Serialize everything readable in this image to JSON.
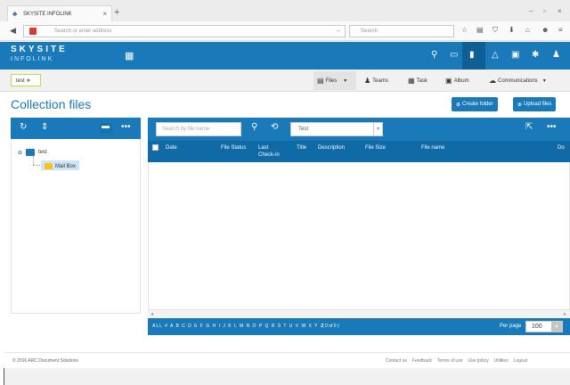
{
  "browser": {
    "tab_title": "SKYSITE INFOLINK",
    "tab_close": "×",
    "new_tab": "+",
    "url_placeholder": "Search or enter address",
    "search_placeholder": "Search",
    "window_controls": [
      "–",
      "▫",
      "×"
    ]
  },
  "app": {
    "logo_top": "SKYSITE",
    "logo_bottom": "INFOLINK",
    "project_selector": "test ≑",
    "nav": [
      {
        "icon": "files-icon",
        "label": "Files",
        "glyph": "▤"
      },
      {
        "icon": "teams-icon",
        "label": "Teams",
        "glyph": "♟"
      },
      {
        "icon": "task-icon",
        "label": "Task",
        "glyph": "▦"
      },
      {
        "icon": "album-icon",
        "label": "Album",
        "glyph": "▣"
      },
      {
        "icon": "communications-icon",
        "label": "Communications",
        "glyph": "☁"
      }
    ],
    "page_title": "Collection files",
    "create_folder": "Create folder",
    "upload_files": "Upload files"
  },
  "tree": {
    "root": "test",
    "child": "Mail Box"
  },
  "files": {
    "search_placeholder": "Search by file name",
    "folder_select": "Test",
    "columns": [
      "Date",
      "File Status",
      "Last Check-in",
      "Title",
      "Description",
      "File Size",
      "File name",
      "Do"
    ],
    "alphabet": "ALL # A B C D E F G H I J K L M N O P Q R S T U V W X Y Z",
    "count": "( 0 of 0 )",
    "per_page_label": "Per page",
    "per_page_value": "100"
  },
  "footer": {
    "copyright": "© 2016 ARC Document Solutions",
    "links": [
      "Contact us",
      "Feedback",
      "Terms of use",
      "Use policy",
      "Utilities",
      "Logout"
    ]
  },
  "colors": {
    "brand_blue": "#1a79b8",
    "header_dark": "#0f6aa6",
    "selection": "#cde6f7",
    "folder": "#f5c518"
  }
}
